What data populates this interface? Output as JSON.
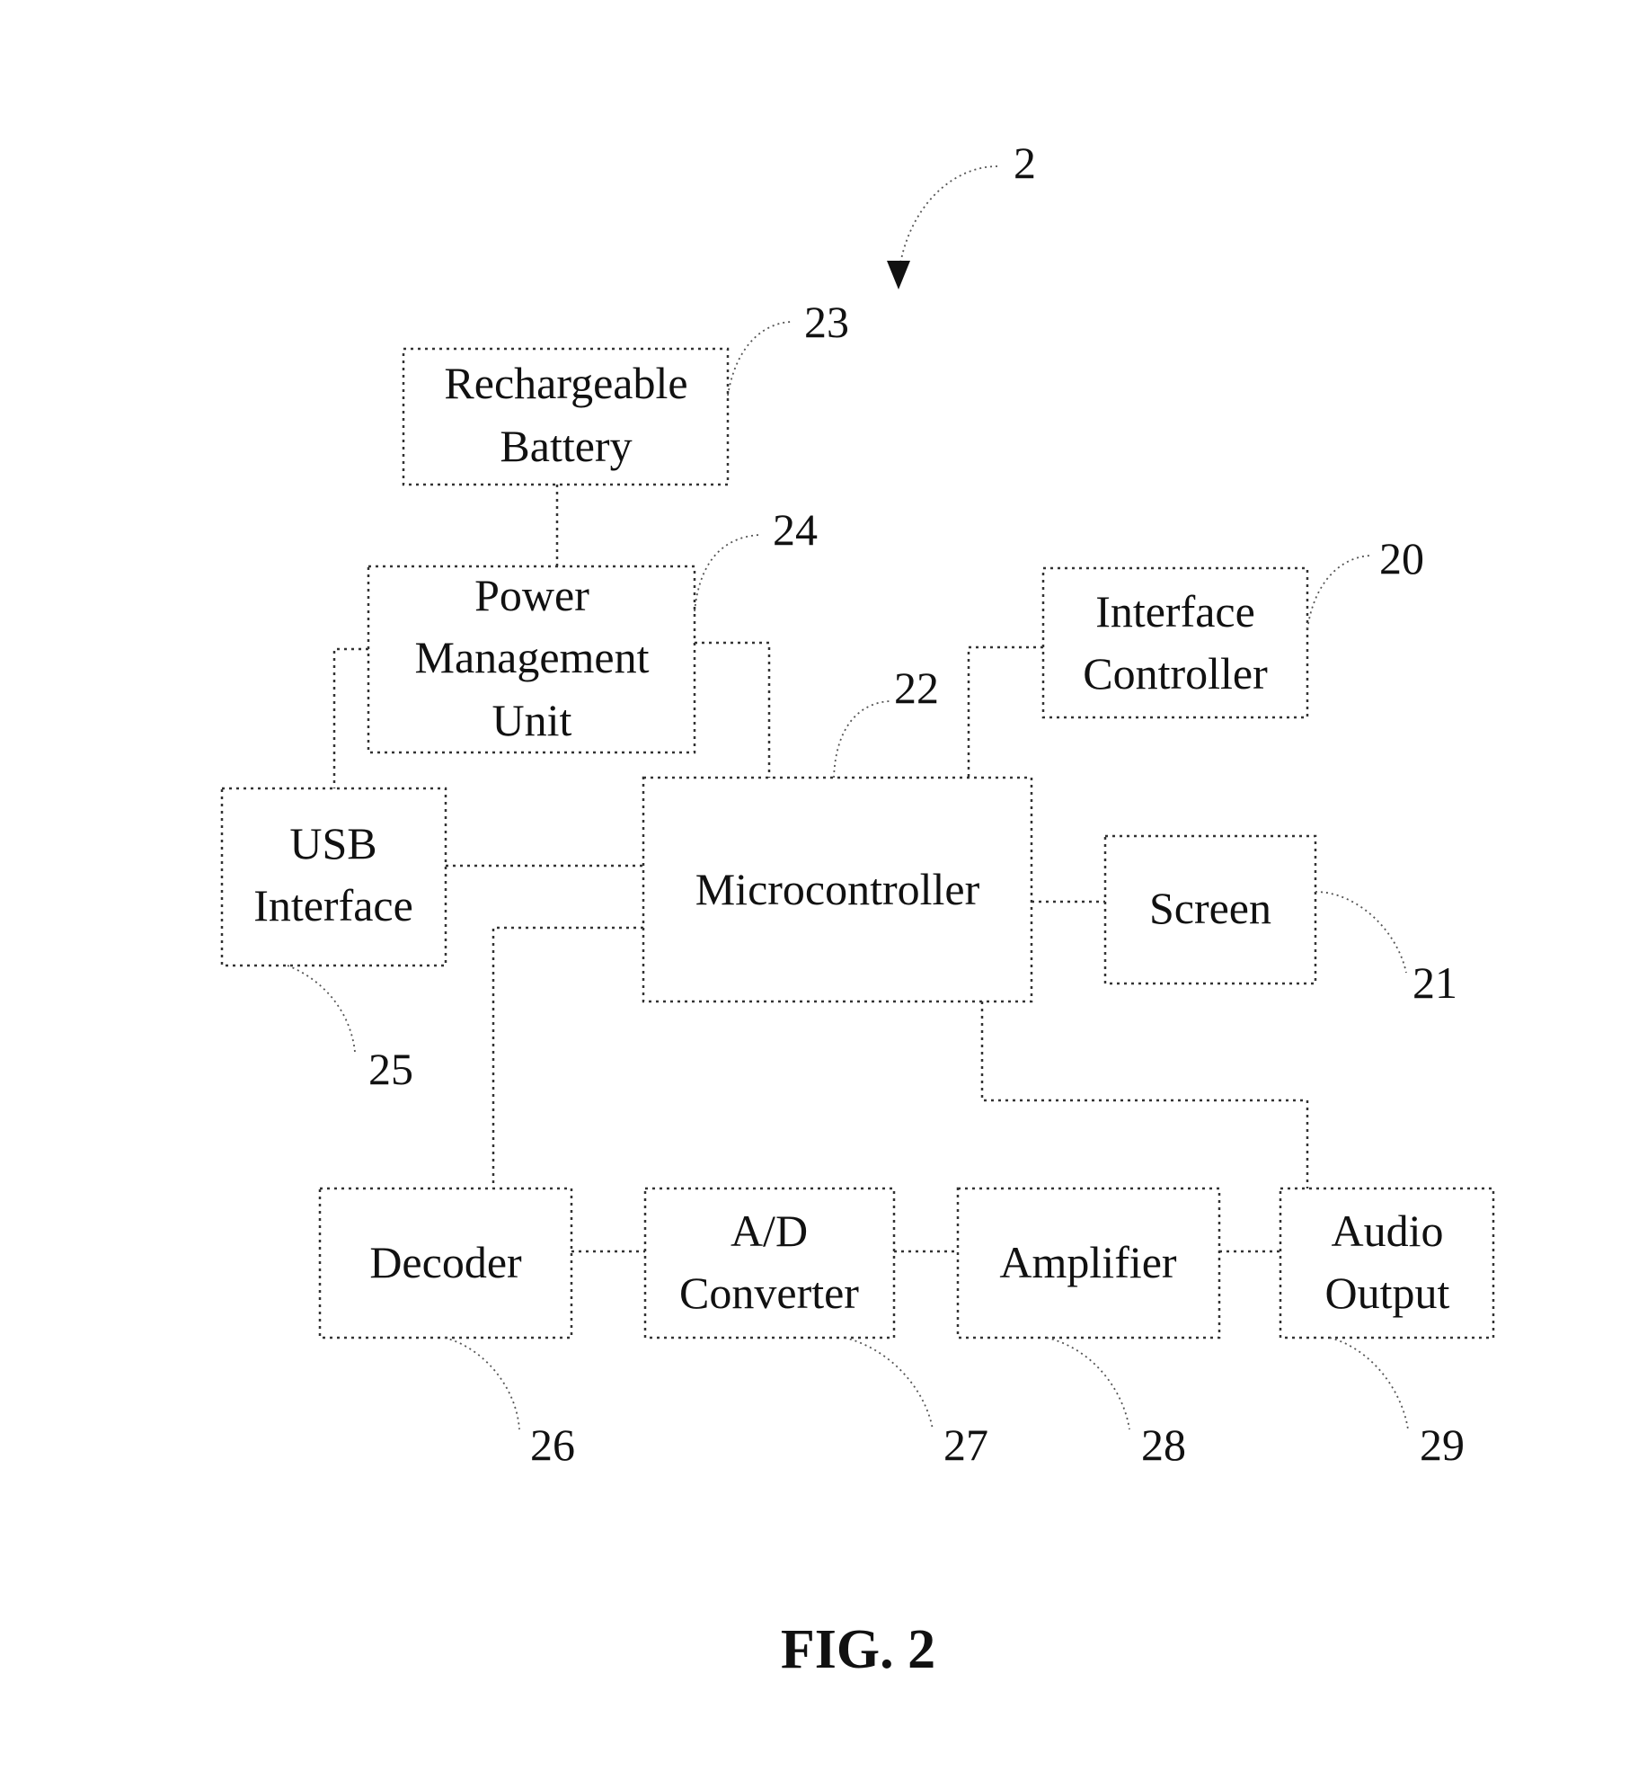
{
  "figure": {
    "caption": "FIG. 2",
    "system_ref": "2"
  },
  "blocks": {
    "battery": {
      "lines": [
        "Rechargeable",
        "Battery"
      ],
      "ref": "23"
    },
    "pmu": {
      "lines": [
        "Power",
        "Management",
        "Unit"
      ],
      "ref": "24"
    },
    "interface_controller": {
      "lines": [
        "Interface",
        "Controller"
      ],
      "ref": "20"
    },
    "usb": {
      "lines": [
        "USB",
        "Interface"
      ],
      "ref": "25"
    },
    "microcontroller": {
      "lines": [
        "Microcontroller"
      ],
      "ref": "22"
    },
    "screen": {
      "lines": [
        "Screen"
      ],
      "ref": "21"
    },
    "decoder": {
      "lines": [
        "Decoder"
      ],
      "ref": "26"
    },
    "ad_converter": {
      "lines": [
        "A/D",
        "Converter"
      ],
      "ref": "27"
    },
    "amplifier": {
      "lines": [
        "Amplifier"
      ],
      "ref": "28"
    },
    "audio_output": {
      "lines": [
        "Audio",
        "Output"
      ],
      "ref": "29"
    }
  },
  "connections": [
    [
      "battery",
      "pmu"
    ],
    [
      "pmu",
      "usb"
    ],
    [
      "pmu",
      "microcontroller"
    ],
    [
      "interface_controller",
      "microcontroller"
    ],
    [
      "usb",
      "microcontroller"
    ],
    [
      "microcontroller",
      "screen"
    ],
    [
      "microcontroller",
      "decoder"
    ],
    [
      "microcontroller",
      "audio_output"
    ],
    [
      "decoder",
      "ad_converter"
    ],
    [
      "ad_converter",
      "amplifier"
    ],
    [
      "amplifier",
      "audio_output"
    ]
  ]
}
